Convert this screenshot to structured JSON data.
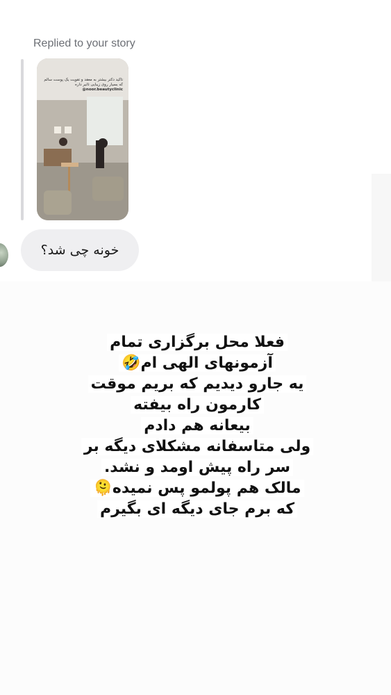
{
  "conversation": {
    "reply_label": "Replied to your story",
    "story": {
      "caption": "تاکید دکتر بیشتر به معقد و تقویت یک پوست سالم که بسیار روی زیبایی تاثیر داره",
      "handle": "@noor.beautyclinic"
    },
    "received_message": "خونه چی شد؟",
    "story_post": {
      "lines": [
        "فعلا محل برگزاری تمام",
        "آزمونهای الهی ام🤣",
        "یه جارو دیدیم که بریم موقت",
        "کارمون راه بیفته",
        "بیعانه هم دادم",
        "ولی متاسفانه مشکلای دیگه بر",
        "سر راه پیش اومد و نشد.",
        "مالک هم پولمو پس نمیده🫠",
        "که برم جای دیگه ای بگیرم"
      ]
    }
  },
  "colors": {
    "bubble": "#efeff1",
    "label": "#6c6f75",
    "reply_bar": "#d9d9dc"
  }
}
